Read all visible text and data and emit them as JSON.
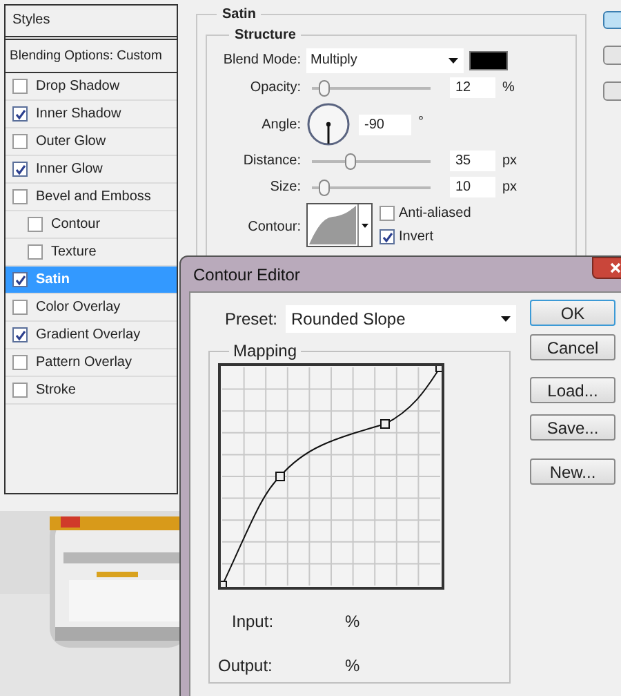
{
  "styles_panel": {
    "title": "Styles",
    "blending_options": "Blending Options: Custom",
    "items": [
      {
        "label": "Drop Shadow",
        "checked": false,
        "selected": false
      },
      {
        "label": "Inner Shadow",
        "checked": true,
        "selected": false
      },
      {
        "label": "Outer Glow",
        "checked": false,
        "selected": false
      },
      {
        "label": "Inner Glow",
        "checked": true,
        "selected": false
      },
      {
        "label": "Bevel and Emboss",
        "checked": false,
        "selected": false,
        "children": [
          {
            "label": "Contour",
            "checked": false,
            "selected": false
          },
          {
            "label": "Texture",
            "checked": false,
            "selected": false
          }
        ]
      },
      {
        "label": "Satin",
        "checked": true,
        "selected": true
      },
      {
        "label": "Color Overlay",
        "checked": false,
        "selected": false
      },
      {
        "label": "Gradient Overlay",
        "checked": true,
        "selected": false
      },
      {
        "label": "Pattern Overlay",
        "checked": false,
        "selected": false
      },
      {
        "label": "Stroke",
        "checked": false,
        "selected": false
      }
    ]
  },
  "satin": {
    "title": "Satin",
    "structure": {
      "title": "Structure",
      "blend_mode": {
        "label": "Blend Mode:",
        "value": "Multiply"
      },
      "opacity": {
        "label": "Opacity:",
        "value": "12",
        "unit": "%",
        "level": 0.1
      },
      "angle": {
        "label": "Angle:",
        "value": "-90",
        "unit": "°"
      },
      "distance": {
        "label": "Distance:",
        "value": "35",
        "unit": "px",
        "level": 0.33
      },
      "size": {
        "label": "Size:",
        "value": "10",
        "unit": "px",
        "level": 0.1
      },
      "contour": {
        "label": "Contour:"
      },
      "options": [
        {
          "label": "Anti-aliased",
          "checked": false
        },
        {
          "label": "Invert",
          "checked": true
        }
      ]
    }
  },
  "contour_editor": {
    "title": "Contour Editor",
    "preset": {
      "label": "Preset:",
      "value": "Rounded Slope"
    },
    "mapping": {
      "title": "Mapping",
      "input": {
        "label": "Input:",
        "unit": "%"
      },
      "output": {
        "label": "Output:",
        "unit": "%"
      }
    },
    "buttons": [
      {
        "label": "OK",
        "default": true
      },
      {
        "label": "Cancel",
        "default": false
      },
      {
        "label": "Load...",
        "default": false
      },
      {
        "label": "Save...",
        "default": false
      },
      {
        "label": "New...",
        "default": false
      }
    ]
  }
}
